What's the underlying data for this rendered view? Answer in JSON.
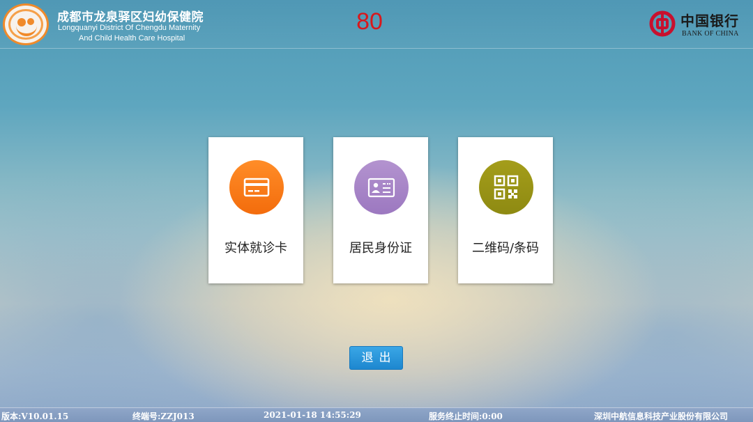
{
  "header": {
    "hospital_name_cn": "成都市龙泉驿区妇幼保健院",
    "hospital_name_en_line1": "Longquanyi District Of Chengdu Maternity",
    "hospital_name_en_line2": "And Child Health Care Hospital",
    "countdown": "80",
    "bank_name_cn": "中国银行",
    "bank_name_en": "BANK OF CHINA"
  },
  "cards": {
    "physical_card": {
      "label": "实体就诊卡",
      "icon": "card-icon",
      "color": "#f47a18"
    },
    "id_card": {
      "label": "居民身份证",
      "icon": "id-card-icon",
      "color": "#a786c8"
    },
    "qr_code": {
      "label": "二维码/条码",
      "icon": "qr-code-icon",
      "color": "#9a9416"
    }
  },
  "exit": {
    "label": "退出"
  },
  "status_bar": {
    "version": "版本:V10.01.15",
    "terminal": "终端号:ZZJ013",
    "datetime": "2021-01-18 14:55:29",
    "service_end": "服务终止时间:0:00",
    "company": "深圳中航信息科技产业股份有限公司"
  },
  "colors": {
    "countdown": "#d8181c",
    "exit_button": "#2996db",
    "hospital_logo": "#f08a2a",
    "bank_logo": "#c8102e"
  }
}
